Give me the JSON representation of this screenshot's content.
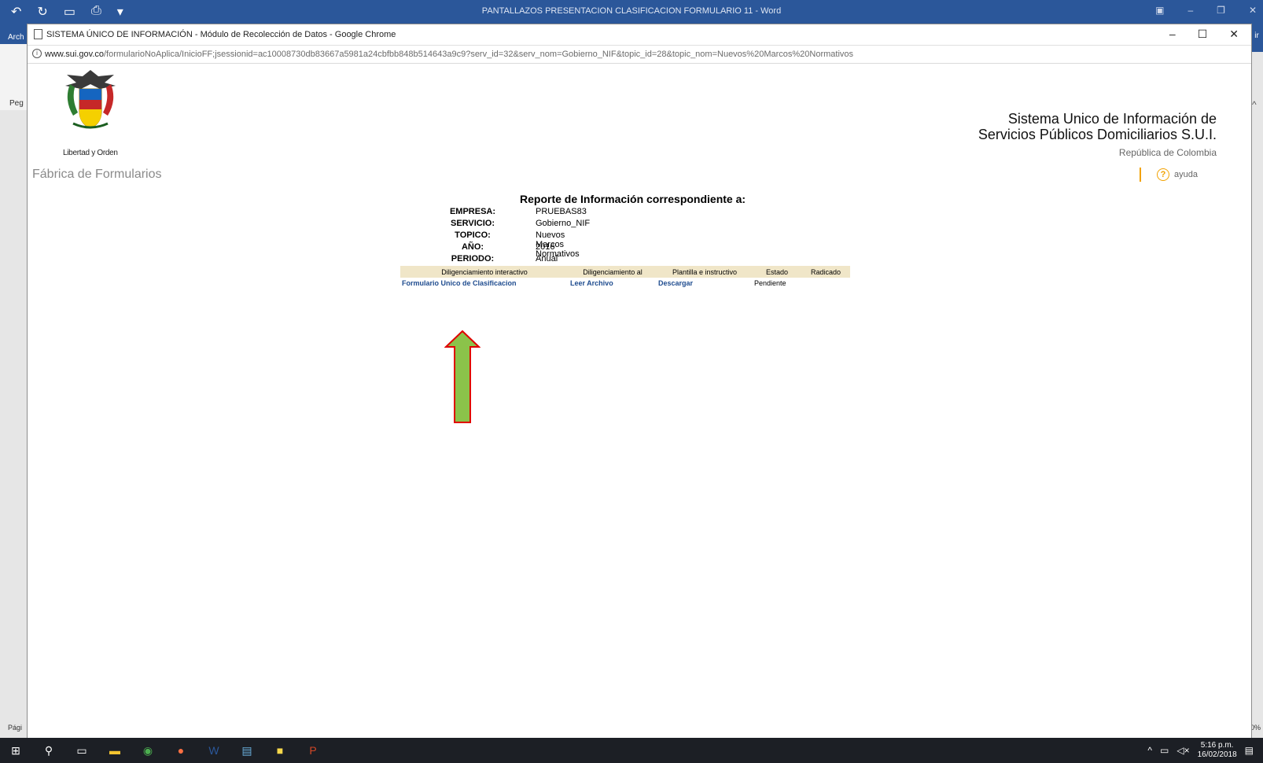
{
  "word": {
    "title": "PANTALLAZOS PRESENTACION CLASIFICACION FORMULARIO 11 - Word",
    "tab_label": "Arch",
    "paste_label": "Peg",
    "status_label": "Pági",
    "right_tab": "ir",
    "zoom_pct": "0%"
  },
  "chrome": {
    "window_title": "SISTEMA ÚNICO DE INFORMACIÓN - Módulo de Recolección de Datos - Google Chrome",
    "url_host": "www.sui.gov.co",
    "url_path": "/formularioNoAplica/InicioFF;jsessionid=ac10008730db83667a5981a24cbfbb848b514643a9c9?serv_id=32&serv_nom=Gobierno_NIF&topic_id=28&topic_nom=Nuevos%20Marcos%20Normativos"
  },
  "header": {
    "logo_caption": "Libertad y Orden",
    "app_name": "Fábrica de Formularios",
    "sui_line1": "Sistema Unico de Información de",
    "sui_line2": "Servicios Públicos Domiciliarios S.U.I.",
    "country": "República de Colombia",
    "help_label": "ayuda"
  },
  "report": {
    "heading": "Reporte de Información correspondiente a:",
    "meta": [
      {
        "key": "EMPRESA:",
        "value": "PRUEBAS83"
      },
      {
        "key": "SERVICIO:",
        "value": "Gobierno_NIF"
      },
      {
        "key": "TOPICO:",
        "value": "Nuevos Marcos Normativos"
      },
      {
        "key": "AÑO:",
        "value": "2016"
      },
      {
        "key": "PERIODO:",
        "value": "Anual"
      }
    ],
    "columns": [
      "Diligenciamiento interactivo",
      "Diligenciamiento al",
      "Plantilla e instructivo",
      "Estado",
      "Radicado"
    ],
    "row": {
      "form_link": "Formulario Unico de Clasificacion",
      "read_link": "Leer Archivo",
      "download_link": "Descargar",
      "status": "Pendiente",
      "radicado": ""
    }
  },
  "taskbar": {
    "time": "5:16 p.m.",
    "date": "16/02/2018"
  },
  "colors": {
    "word_blue": "#2b579a",
    "table_header": "#f0e6c8",
    "link": "#1f4c8f",
    "help_orange": "#f2a200",
    "arrow_fill": "#8bc34a",
    "arrow_stroke": "#e00000"
  }
}
